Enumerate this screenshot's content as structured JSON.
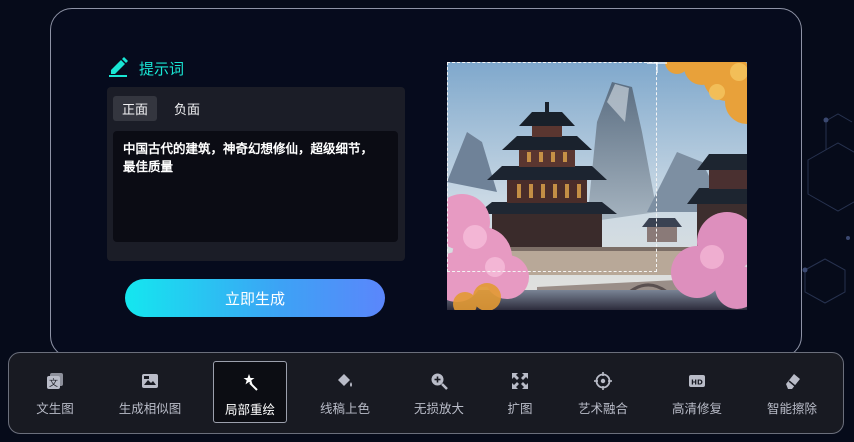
{
  "prompt": {
    "title": "提示词",
    "tabs": [
      {
        "label": "正面",
        "active": true
      },
      {
        "label": "负面",
        "active": false
      }
    ],
    "text": "中国古代的建筑，神奇幻想修仙，超级细节，\n最佳质量"
  },
  "generate_button": {
    "label": "立即生成"
  },
  "toolbar": {
    "items": [
      {
        "label": "文生图",
        "icon": "text-to-image-icon",
        "active": false
      },
      {
        "label": "生成相似图",
        "icon": "similar-image-icon",
        "active": false
      },
      {
        "label": "局部重绘",
        "icon": "magic-wand-icon",
        "active": true
      },
      {
        "label": "线稿上色",
        "icon": "paint-bucket-icon",
        "active": false
      },
      {
        "label": "无损放大",
        "icon": "zoom-in-icon",
        "active": false
      },
      {
        "label": "扩图",
        "icon": "expand-icon",
        "active": false
      },
      {
        "label": "艺术融合",
        "icon": "target-icon",
        "active": false
      },
      {
        "label": "高清修复",
        "icon": "hd-icon",
        "active": false
      },
      {
        "label": "智能擦除",
        "icon": "eraser-icon",
        "active": false
      }
    ]
  },
  "colors": {
    "accent": "#19e6d4",
    "gradient_start": "#14e7ef",
    "gradient_end": "#5b86fb",
    "background": "#060b1a"
  }
}
